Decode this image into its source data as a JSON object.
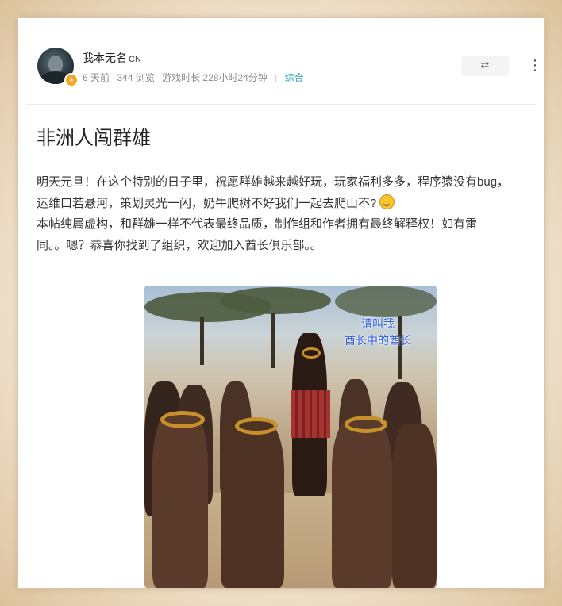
{
  "author": {
    "name": "我本无名",
    "name_suffix": "CN",
    "avatar_icon": "user-avatar",
    "badge_icon": "star-badge-icon"
  },
  "meta": {
    "time": "6 天前",
    "views": "344 浏览",
    "playtime": "游戏时长 228小时24分钟",
    "category": "综合"
  },
  "actions": {
    "share_icon": "⇄",
    "more_icon": "⋮"
  },
  "post": {
    "title": "非洲人闯群雄",
    "paragraph1_line1": "明天元旦！在这个特别的日子里，祝愿群雄越来越好玩，玩家福利多多，程序猿没有bug，",
    "paragraph1_line2": "运维口若悬河，策划灵光一闪，奶牛爬树不好我们一起去爬山不?",
    "paragraph2_line1": "本帖纯属虚构，和群雄一样不代表最终品质，制作组和作者拥有最终解释权！如有雷",
    "paragraph2_line2": "同。。嗯？恭喜你找到了组织，欢迎加入酋长俱乐部。。"
  },
  "image": {
    "caption_line1": "请叫我",
    "caption_line2": "酋长中的酋长"
  },
  "colors": {
    "accent": "#3ca6b9",
    "caption": "#2f5de0",
    "badge": "#f5a623"
  }
}
